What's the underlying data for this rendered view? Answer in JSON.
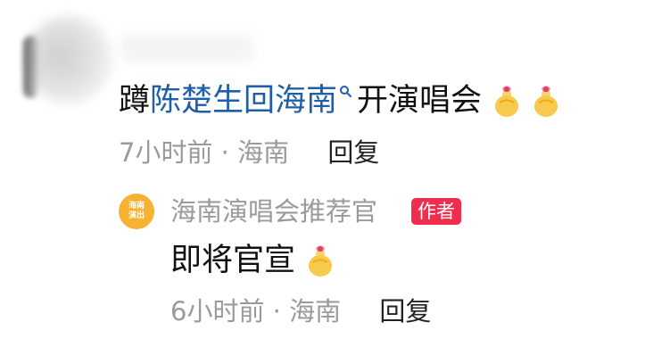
{
  "comment": {
    "text_prefix": "蹲",
    "link_text": "陈楚生回海南",
    "text_suffix": "开演唱会",
    "emojis": [
      "gift-bag-emoji",
      "gift-bag-emoji"
    ],
    "time": "7小时前 · 海南",
    "reply_label": "回复"
  },
  "reply": {
    "avatar_text_line1": "海南",
    "avatar_text_line2": "演出",
    "author_name": "海南演唱会推荐官",
    "author_badge": "作者",
    "text": "即将官宣",
    "emojis": [
      "gift-bag-emoji"
    ],
    "time": "6小时前 · 海南",
    "reply_label": "回复"
  },
  "colors": {
    "link": "#1f5fa8",
    "meta": "#9a9a9a",
    "author_badge": "#ef2e4f",
    "reply_avatar": "#f7b233"
  }
}
